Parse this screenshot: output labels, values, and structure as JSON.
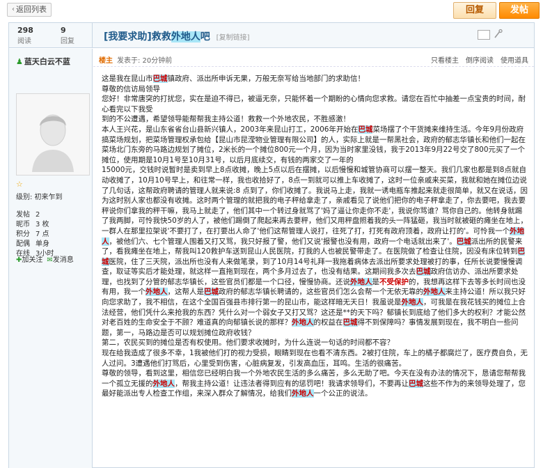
{
  "toolbar": {
    "back_label": "返回列表",
    "reply_label": "回复",
    "post_label": "发帖"
  },
  "thread": {
    "views": "298",
    "views_label": "阅读",
    "replies": "9",
    "replies_label": "回复",
    "title_prefix": "[我要求助]救救",
    "title_hl": "外地人",
    "title_suffix": "吧",
    "copy_label": "[复制链接]"
  },
  "user": {
    "name": "蓝天白云不蓝",
    "level": "级别: 初来乍到",
    "stats": [
      {
        "k": "发帖",
        "v": "2"
      },
      {
        "k": "昵币",
        "v": "3 枚"
      },
      {
        "k": "积分",
        "v": "7 点"
      },
      {
        "k": "配偶",
        "v": "单身"
      },
      {
        "k": "在线",
        "v": "3小时"
      }
    ],
    "add_friend": "加关注",
    "send_msg": "发消息"
  },
  "post": {
    "host_label": "楼主",
    "time": "发表于: 20分钟前",
    "actions": [
      "只看楼主",
      "倒序阅读",
      "使用道具"
    ]
  },
  "body": [
    [
      {
        "t": "这是我在昆山市"
      },
      {
        "t": "巴城",
        "c": "redhl"
      },
      {
        "t": "镇政府、派出所申诉无果，万般无奈写给当地部门的求助信！"
      }
    ],
    [
      {
        "t": "尊敬的信访局领导"
      }
    ],
    [
      {
        "t": "  您好！非常唐突的打扰您，实在是迫不得已，被逼无奈，只能怀着一个期盼的心情向您求救。请您在百忙中抽差一点宝贵的时间，耐心看完以下我受"
      }
    ],
    [
      {
        "t": "到的不公遭遇，希望领导能帮帮我主持公道！救救一个外地农民，不胜感激！"
      }
    ],
    [
      {
        "t": "本人王兴花，是山东省省台山县新兴镇人，2003年来昆山打工，2006年开始在"
      },
      {
        "t": "巴城",
        "c": "redhl"
      },
      {
        "t": "菜场摆了个干货摊来维持生活。今年9月份政府搞菜场规划，把菜场管理权承包给【昆山市昆滢物业管理有限公司】的人，实际上就是一帮黑社会，政府的郁志华镇长和他们一起在菜场北门东旁的马路边规划了摊位，2米长的一个摊位800元一个月，因为当时家里没钱，我于2013年9月22号交了800元买了一个摊位，使用期是10月1号至10月31号，以后月底续交，有钱的两家交了一年的"
      }
    ],
    [
      {
        "t": "15000元，交钱时说暂时是卖到早上8点收摊，晚上5点以后在摆摊，以后慢慢和城管协商可以摆一整天。我们几家也都是到8点就自动收摊了，10月10号早上，和往常一样，我也收拾好了，8点一到就可以推上车收摊了，这时一位亲戚来买菜，我就和她在摊位边说了几句话，这帮政府聘请的管理人就来说:8 点到了，你们收摊了。我说马上走，我就一诱电瓶车推起来就走很简单，就又在说话，因为这时别人家也都没有收摊。这时两个管理的就把我的电子秤给拿走了，亲戚看见了说他们把你的电子秤拿走了，你去要吧，我去要秤说你们拿我的秤干嘛，我马上就走了，他们其中一个转过身就骂了'妈了逼让你走你不走'，我说你骂谁？骂你自己的。他转身就踢了我两脚，可怜我快50岁的人了，被他们踢倒了爬起来再去要秤，他们又用秤盘照着我的头一阵猛砸，我当时就被砸的瘫坐在地上，一群人在那里拉架说'不要打了，在打要出人命了'他们这帮管理人说打，往死了打，打死有政府顶着，政府让打的'。可怜我一个"
      },
      {
        "t": "外地人",
        "c": "redhl"
      },
      {
        "t": "，被他们六、七个管理人围着又打又骂，我只好报了警，他们又说'报警也没有用，政府一个电话就出来了'。"
      },
      {
        "t": "巴城",
        "c": "redhl"
      },
      {
        "t": "派出所的民警来了，看我瘫坐在地上，帮我叫120救护车送到昆山人民医院，打我的人也被民警带走了。在医院做了检查让住院，因没有床位转到"
      },
      {
        "t": "巴城",
        "c": "redhl"
      },
      {
        "t": "医院，住了三天院，派出所也没有人来做笔录，到了10月14号礼拜一我拖着病体去派出所要求处理被打的事，任所长说要慢慢调查，取证等实后才能处理，就这样一直拖到现在，两个多月过去了，也没有结果。这期间我多次去"
      },
      {
        "t": "巴城",
        "c": "redhl"
      },
      {
        "t": "政府信访办、派出所要求处理，也找到了分管的郁志华镇长，这些官员们都是一个口径，慢慢协商。还说"
      },
      {
        "t": "外地人",
        "c": "redhl"
      },
      {
        "t": "是"
      },
      {
        "t": "不受保护",
        "c": "red"
      },
      {
        "t": "的，我想再这样下去等多长时间也没有用，我一个"
      },
      {
        "t": "外地人",
        "c": "redhl"
      },
      {
        "t": "，这帮人是"
      },
      {
        "t": "巴城",
        "c": "redhl"
      },
      {
        "t": "政府的郁志华镇长聘请的，这些官员们怎么会帮一个无依无靠的"
      },
      {
        "t": "外地人",
        "c": "redhl"
      },
      {
        "t": "来主持公道！所以我只好向您求助了，我不相信，在这个全国百强县市排行第一的昆山市，能这样暗无天日！我虽说是"
      },
      {
        "t": "外地人",
        "c": "redhl"
      },
      {
        "t": "，可我是在我花钱买的摊位上合法经营，他们凭什么来抢我的东西？凭什么对一个弱女子又打又骂？这还是**的天下吗？郁镇长到底给了他们多大的权利？才能公然对老百姓的生命安全于不顾？难道真的向郁镇长说的那样？"
      },
      {
        "t": "外地人",
        "c": "redhl"
      },
      {
        "t": "的权益在"
      },
      {
        "t": "巴城",
        "c": "redhl"
      },
      {
        "t": "得不到保障吗？事情发展到现在，我不明白一些问题，第一，马路边是否可以规划摊位政府收钱？"
      }
    ],
    [
      {
        "t": "第二，农民买到的摊位是否有权使用。他们要求收摊时，为什么连说一句话的时间都不容？"
      }
    ],
    [
      {
        "t": "现在给我造成了很多不幸，1我被他们打的视力受损，眼睛到现在也看不清东西。2被打住院，车上的橘子都腐烂了，医疗费自负，无人过问。3遭遇他们打骂后，心里受到伤害，心脏病复发，引发高血压，耳鸣。生活的很痛苦。"
      }
    ],
    [
      {
        "t": "尊敬的领导，看到这里，相信您已经明白我一个外地农民生活的多么痛苦，多么无助了吧。今天在没有办法的情况下，恳请您帮帮我一个孤立无援的"
      },
      {
        "t": "外地人",
        "c": "redhl"
      },
      {
        "t": "，帮我主持公道！让违法者得到应有的惩罚吧！我请求领导们，不要再让"
      },
      {
        "t": "巴城",
        "c": "redhl"
      },
      {
        "t": "这些不作为的来领导处理了，您最好能派出专人检查工作组，来深入群众了解情况，给我们"
      },
      {
        "t": "外地人",
        "c": "redhl"
      },
      {
        "t": "一个公正的说法。"
      }
    ]
  ]
}
